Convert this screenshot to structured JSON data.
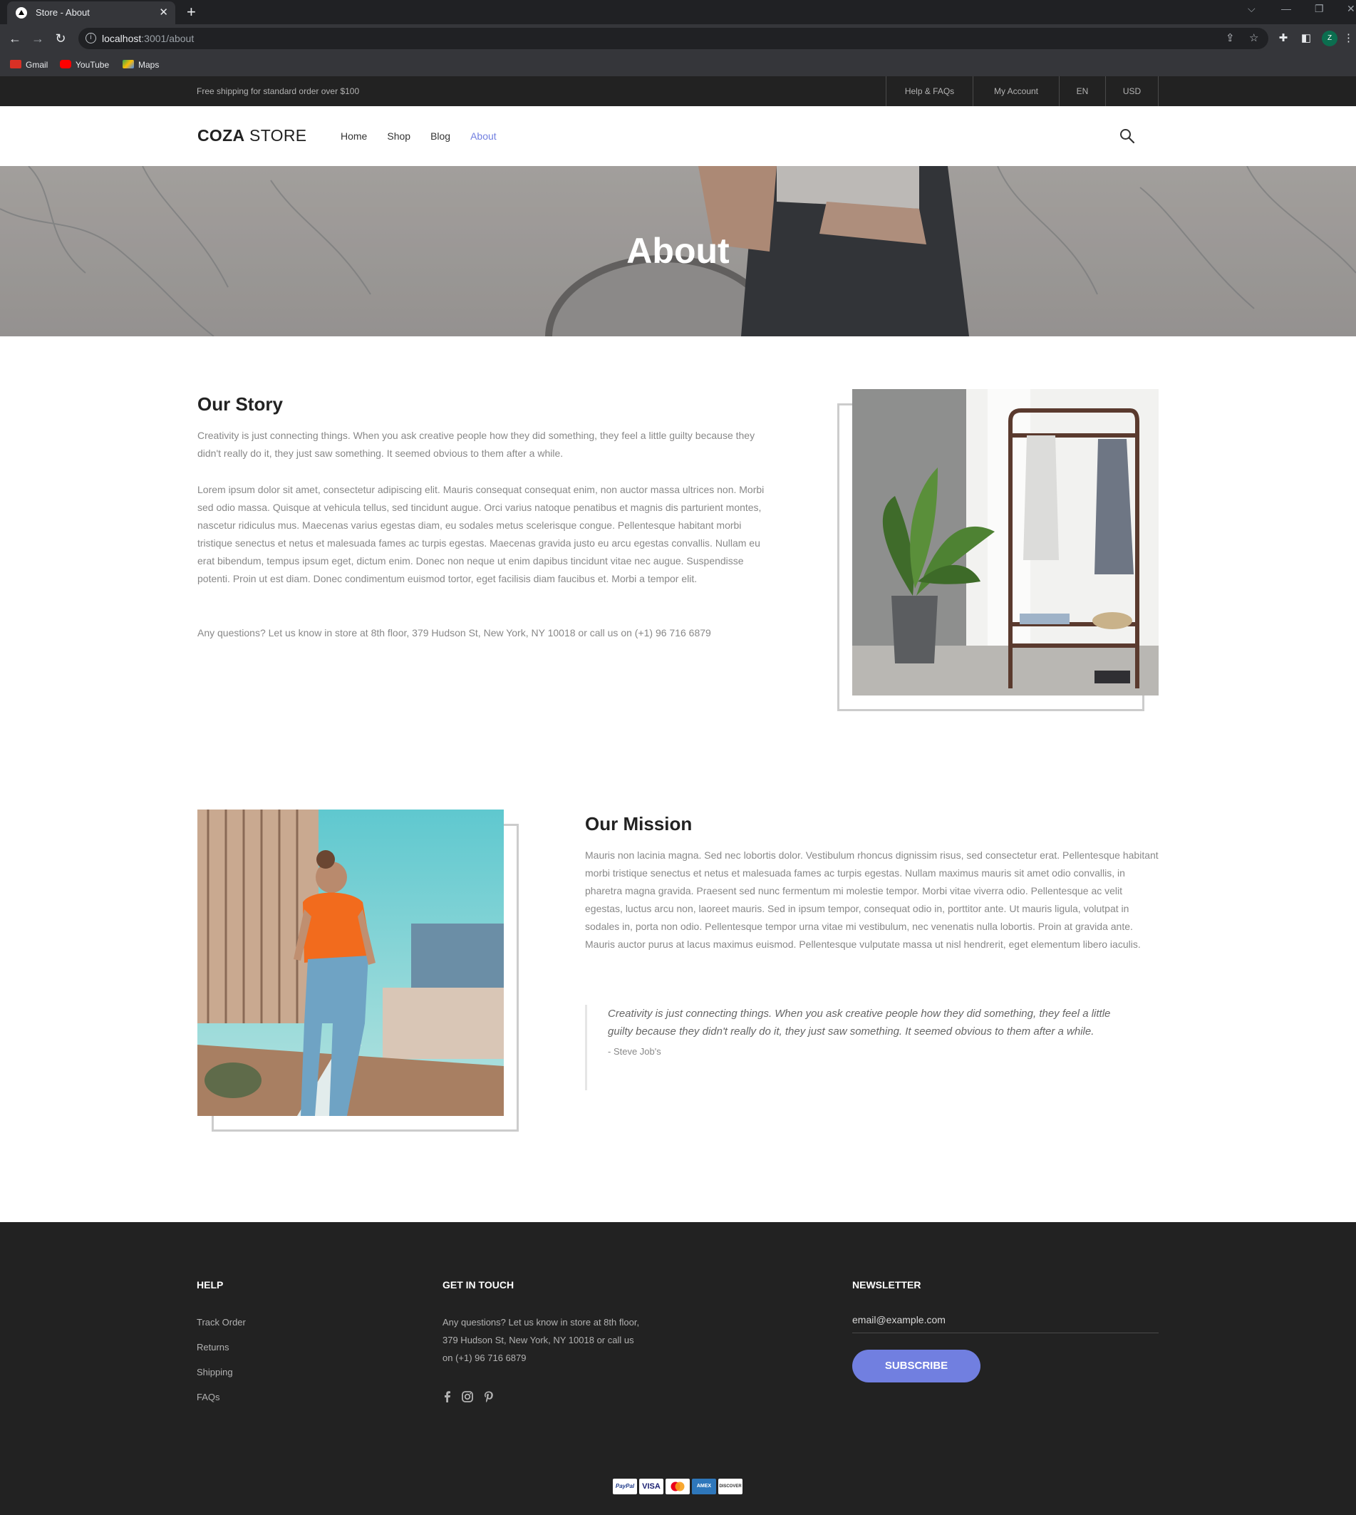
{
  "browser": {
    "tab_title": "Store - About",
    "tab_close": "✕",
    "new_tab": "+",
    "url_host": "localhost",
    "url_path": ":3001/about",
    "bookmarks": [
      {
        "label": "Gmail",
        "icon": "gmail-icon",
        "color": "#d93025"
      },
      {
        "label": "YouTube",
        "icon": "youtube-icon",
        "color": "#ff0000"
      },
      {
        "label": "Maps",
        "icon": "maps-icon",
        "color": "#34a853"
      }
    ],
    "profile_initial": "Z"
  },
  "topbar": {
    "shipping_text": "Free shipping for standard order over $100",
    "links": [
      "Help & FAQs",
      "My Account",
      "EN",
      "USD"
    ]
  },
  "header": {
    "logo_bold": "COZA",
    "logo_light": " STORE",
    "menu": [
      "Home",
      "Shop",
      "Blog",
      "About"
    ],
    "active_menu": "About",
    "accent_color": "#717fe0"
  },
  "hero": {
    "title": "About"
  },
  "story": {
    "title": "Our Story",
    "paragraphs": [
      "Creativity is just connecting things. When you ask creative people how they did something, they feel a little guilty because they didn't really do it, they just saw something. It seemed obvious to them after a while.",
      "Lorem ipsum dolor sit amet, consectetur adipiscing elit. Mauris consequat consequat enim, non auctor massa ultrices non. Morbi sed odio massa. Quisque at vehicula tellus, sed tincidunt augue. Orci varius natoque penatibus et magnis dis parturient montes, nascetur ridiculus mus. Maecenas varius egestas diam, eu sodales metus scelerisque congue. Pellentesque habitant morbi tristique senectus et netus et malesuada fames ac turpis egestas. Maecenas gravida justo eu arcu egestas convallis. Nullam eu erat bibendum, tempus ipsum eget, dictum enim. Donec non neque ut enim dapibus tincidunt vitae nec augue. Suspendisse potenti. Proin ut est diam. Donec condimentum euismod tortor, eget facilisis diam faucibus et. Morbi a tempor elit.",
      "Any questions? Let us know in store at 8th floor, 379 Hudson St, New York, NY 10018 or call us on (+1) 96 716 6879"
    ]
  },
  "mission": {
    "title": "Our Mission",
    "paragraph": "Mauris non lacinia magna. Sed nec lobortis dolor. Vestibulum rhoncus dignissim risus, sed consectetur erat. Pellentesque habitant morbi tristique senectus et netus et malesuada fames ac turpis egestas. Nullam maximus mauris sit amet odio convallis, in pharetra magna gravida. Praesent sed nunc fermentum mi molestie tempor. Morbi vitae viverra odio. Pellentesque ac velit egestas, luctus arcu non, laoreet mauris. Sed in ipsum tempor, consequat odio in, porttitor ante. Ut mauris ligula, volutpat in sodales in, porta non odio. Pellentesque tempor urna vitae mi vestibulum, nec venenatis nulla lobortis. Proin at gravida ante. Mauris auctor purus at lacus maximus euismod. Pellentesque vulputate massa ut nisl hendrerit, eget elementum libero iaculis.",
    "quote": "Creativity is just connecting things. When you ask creative people how they did something, they feel a little guilty because they didn't really do it, they just saw something. It seemed obvious to them after a while.",
    "quote_author": "- Steve Job's"
  },
  "footer": {
    "help_title": "HELP",
    "help_links": [
      "Track Order",
      "Returns",
      "Shipping",
      "FAQs"
    ],
    "contact_title": "GET IN TOUCH",
    "contact_text": "Any questions? Let us know in store at 8th floor, 379 Hudson St, New York, NY 10018 or call us on (+1) 96 716 6879",
    "social_icons": [
      "facebook-icon",
      "instagram-icon",
      "pinterest-icon"
    ],
    "newsletter_title": "NEWSLETTER",
    "email_placeholder": "email@example.com",
    "subscribe_label": "SUBSCRIBE",
    "payment_methods": [
      "PayPal",
      "VISA",
      "MC",
      "AMEX",
      "DISCOVER"
    ]
  }
}
